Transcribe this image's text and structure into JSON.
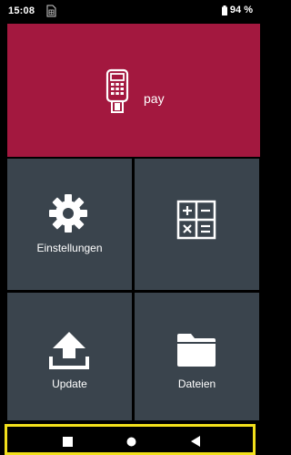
{
  "status_bar": {
    "time": "15:08",
    "sim_icon": "sim-card-icon",
    "battery_icon": "battery-icon",
    "battery_level": "94 %"
  },
  "tiles": {
    "pay": {
      "label": "pay",
      "icon": "card-terminal-icon",
      "color": "#a3183f"
    },
    "settings": {
      "label": "Einstellungen",
      "icon": "gear-icon",
      "color": "#3a444d"
    },
    "calculator": {
      "label": "",
      "icon": "calculator-icon",
      "color": "#3a444d"
    },
    "update": {
      "label": "Update",
      "icon": "upload-icon",
      "color": "#3a444d"
    },
    "files": {
      "label": "Dateien",
      "icon": "folder-icon",
      "color": "#3a444d"
    }
  },
  "nav_bar": {
    "buttons": [
      "recents-square-icon",
      "home-circle-icon",
      "back-triangle-icon"
    ],
    "highlight_color": "#f2e01c"
  }
}
